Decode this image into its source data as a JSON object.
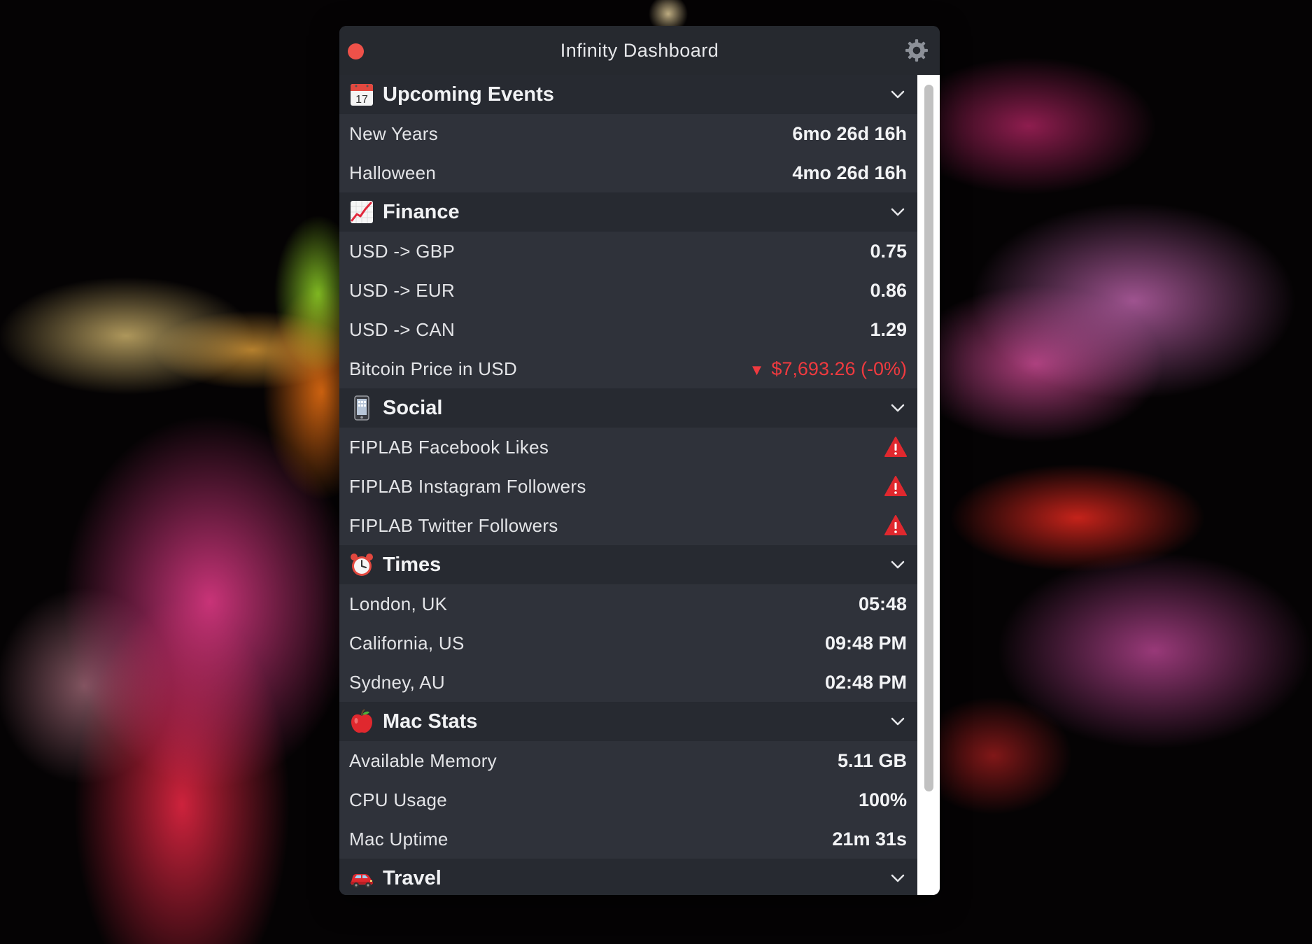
{
  "window": {
    "title": "Infinity Dashboard"
  },
  "sections": {
    "upcoming_events": {
      "title": "Upcoming Events",
      "icon": "calendar-icon",
      "calendar_day": "17",
      "rows": [
        {
          "label": "New Years",
          "value": "6mo 26d 16h"
        },
        {
          "label": "Halloween",
          "value": "4mo 26d 16h"
        }
      ]
    },
    "finance": {
      "title": "Finance",
      "icon": "chart-increasing-icon",
      "rows": [
        {
          "label": "USD -> GBP",
          "value": "0.75"
        },
        {
          "label": "USD -> EUR",
          "value": "0.86"
        },
        {
          "label": "USD -> CAN",
          "value": "1.29"
        },
        {
          "label": "Bitcoin Price in USD",
          "value": "$7,693.26 (-0%)",
          "trend": "down"
        }
      ]
    },
    "social": {
      "title": "Social",
      "icon": "mobile-phone-icon",
      "rows": [
        {
          "label": "FIPLAB Facebook Likes",
          "status": "warning-icon"
        },
        {
          "label": "FIPLAB Instagram Followers",
          "status": "warning-icon"
        },
        {
          "label": "FIPLAB Twitter Followers",
          "status": "warning-icon"
        }
      ]
    },
    "times": {
      "title": "Times",
      "icon": "alarm-clock-icon",
      "rows": [
        {
          "label": "London, UK",
          "value": "05:48"
        },
        {
          "label": "California, US",
          "value": "09:48 PM"
        },
        {
          "label": "Sydney, AU",
          "value": "02:48 PM"
        }
      ]
    },
    "mac_stats": {
      "title": "Mac Stats",
      "icon": "apple-icon",
      "rows": [
        {
          "label": "Available Memory",
          "value": "5.11 GB"
        },
        {
          "label": "CPU Usage",
          "value": "100%"
        },
        {
          "label": "Mac Uptime",
          "value": "21m 31s"
        }
      ]
    },
    "travel": {
      "title": "Travel",
      "icon": "car-icon"
    }
  },
  "colors": {
    "window_bg": "#2d3038",
    "header_bg": "#272a31",
    "close_button": "#ee5149",
    "negative": "#f03a3f",
    "warning": "#e0282e"
  }
}
